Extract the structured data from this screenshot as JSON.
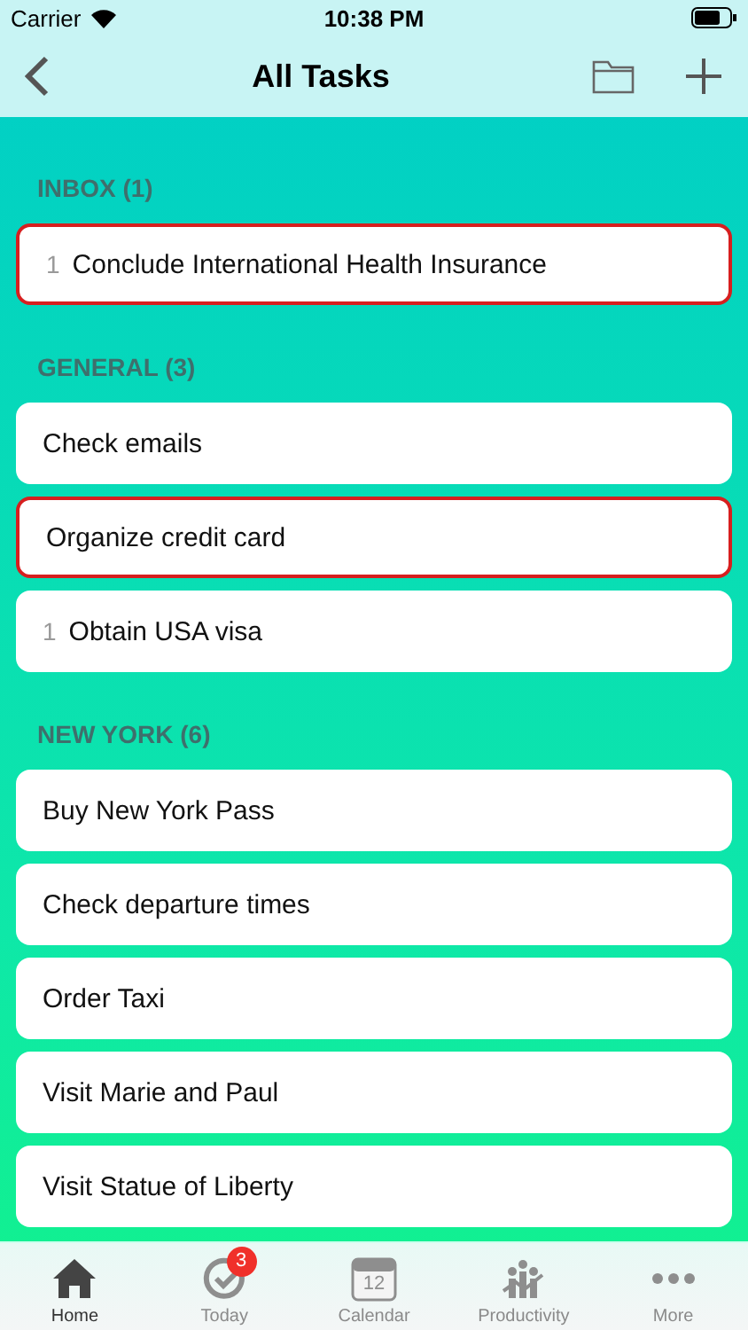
{
  "status_bar": {
    "carrier": "Carrier",
    "time": "10:38 PM"
  },
  "nav": {
    "title": "All Tasks"
  },
  "sections": [
    {
      "title": "INBOX (1)",
      "tasks": [
        {
          "priority": "1",
          "title": "Conclude International Health Insurance",
          "highlighted": true
        }
      ]
    },
    {
      "title": "GENERAL (3)",
      "tasks": [
        {
          "title": "Check emails",
          "highlighted": false
        },
        {
          "title": "Organize credit card",
          "highlighted": true
        },
        {
          "priority": "1",
          "title": "Obtain USA visa",
          "highlighted": false
        }
      ]
    },
    {
      "title": "NEW YORK (6)",
      "tasks": [
        {
          "title": "Buy New York Pass",
          "highlighted": false
        },
        {
          "title": "Check departure times",
          "highlighted": false
        },
        {
          "title": "Order Taxi",
          "highlighted": false
        },
        {
          "title": "Visit Marie and Paul",
          "highlighted": false
        },
        {
          "title": "Visit Statue of Liberty",
          "highlighted": false
        }
      ]
    }
  ],
  "tab_bar": [
    {
      "kind": "home",
      "label": "Home",
      "selected": true
    },
    {
      "kind": "today",
      "label": "Today",
      "selected": false,
      "badge": "3"
    },
    {
      "kind": "calendar",
      "label": "Calendar",
      "selected": false,
      "day": "12"
    },
    {
      "kind": "productivity",
      "label": "Productivity",
      "selected": false
    },
    {
      "kind": "more",
      "label": "More",
      "selected": false
    }
  ]
}
